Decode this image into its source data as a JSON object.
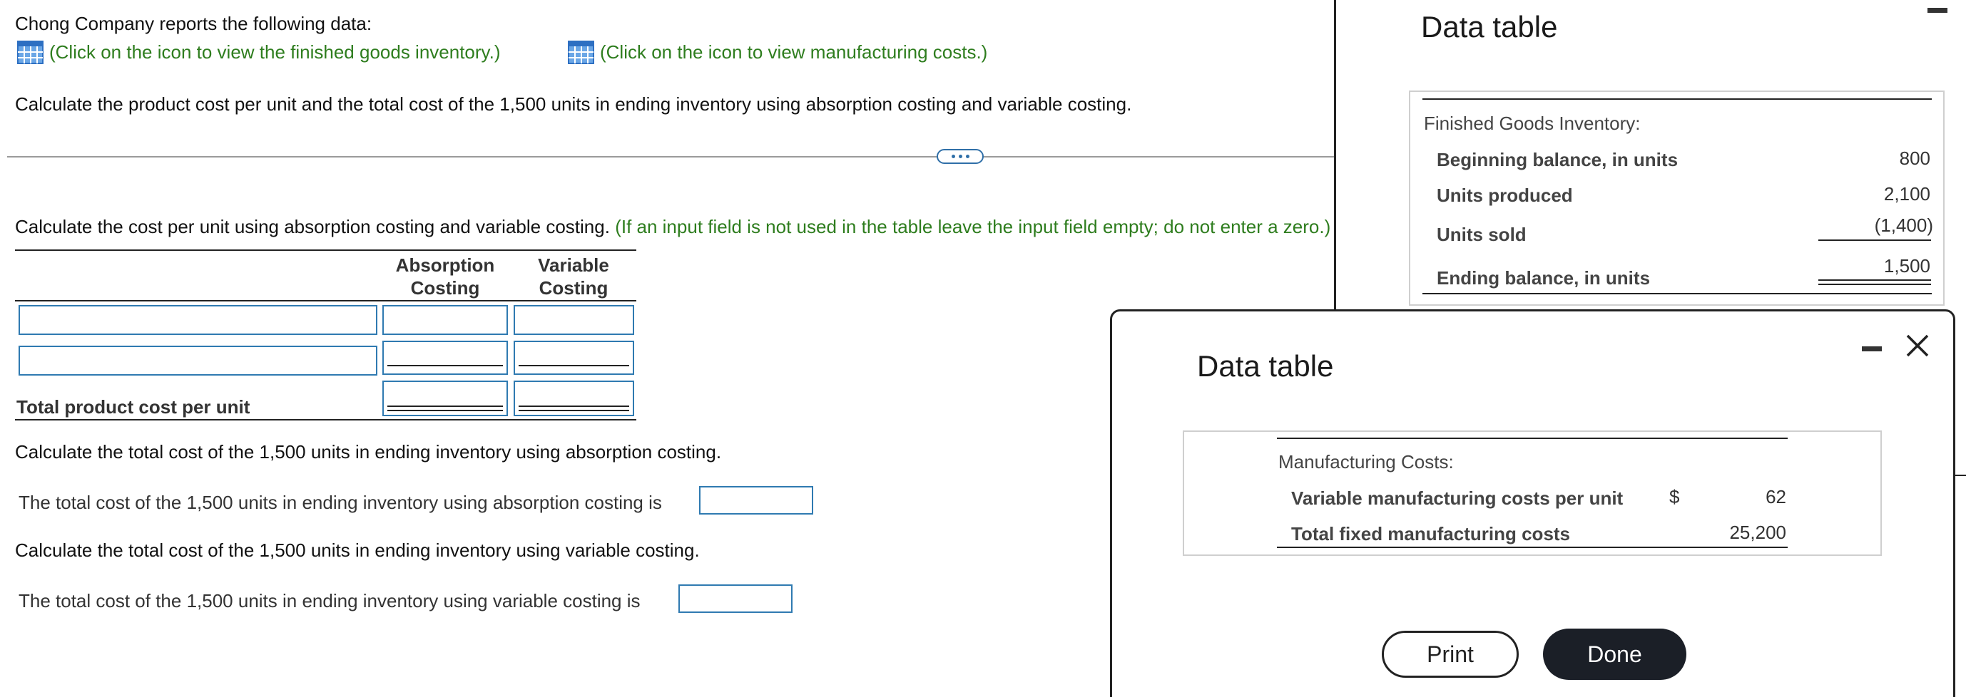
{
  "question": {
    "intro": "Chong Company reports the following data:",
    "link_finished_goods": "(Click on the icon to view the finished goods inventory.)",
    "link_manufacturing": "(Click on the icon to view manufacturing costs.)",
    "instruction": "Calculate the product cost per unit and the total cost of the 1,500 units in ending inventory using absorption costing and variable costing.",
    "part1_prompt": "Calculate the cost per unit using absorption costing and variable costing.",
    "part1_hint": "(If an input field is not used in the table leave the input field empty; do not enter a zero.)",
    "col_absorption": [
      "Absorption",
      "Costing"
    ],
    "col_variable": [
      "Variable",
      "Costing"
    ],
    "total_label": "Total product cost per unit",
    "part2_prompt": "Calculate the total cost of the 1,500 units in ending inventory using absorption costing.",
    "part2_sentence": "The total cost of the 1,500 units in ending inventory using absorption costing is",
    "part3_prompt": "Calculate the total cost of the 1,500 units in ending inventory using variable costing.",
    "part3_sentence": "The total cost of the 1,500 units in ending inventory using variable costing is",
    "inputs": {
      "row1_label": "",
      "row1_absorption": "",
      "row1_variable": "",
      "row2_label": "",
      "row2_absorption": "",
      "row2_variable": "",
      "total_absorption": "",
      "total_variable": "",
      "absorption_total_cost": "",
      "variable_total_cost": ""
    }
  },
  "finished_goods_window": {
    "title": "Data table",
    "section": "Finished Goods Inventory:",
    "rows": [
      {
        "label": "Beginning balance, in units",
        "value": "800"
      },
      {
        "label": "Units produced",
        "value": "2,100"
      },
      {
        "label": "Units sold",
        "value": "(1,400)"
      },
      {
        "label": "Ending balance, in units",
        "value": "1,500"
      }
    ]
  },
  "manufacturing_dialog": {
    "title": "Data table",
    "section": "Manufacturing Costs:",
    "rows": [
      {
        "label": "Variable manufacturing costs per unit",
        "currency": "$",
        "value": "62"
      },
      {
        "label": "Total fixed manufacturing costs",
        "currency": "",
        "value": "25,200"
      }
    ],
    "print_label": "Print",
    "done_label": "Done"
  },
  "colors": {
    "link_green": "#2e7d1e",
    "input_border": "#2f7ab1",
    "done_button": "#1b1f27"
  },
  "icons": [
    "table-grid-icon",
    "ellipsis-icon",
    "minimize-icon",
    "close-icon"
  ]
}
